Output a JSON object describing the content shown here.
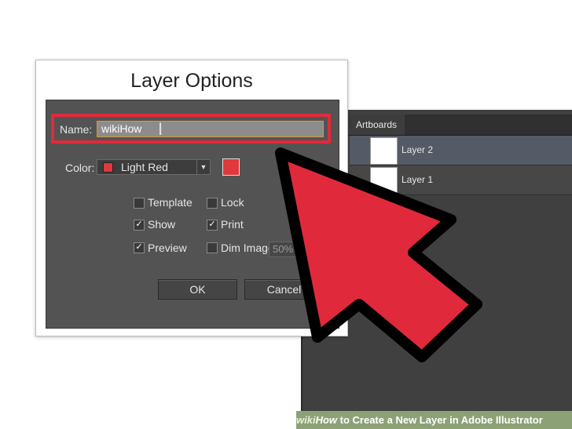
{
  "dialog": {
    "title": "Layer Options",
    "name_label": "Name:",
    "name_value": "wikiHow",
    "color_label": "Color:",
    "color_value": "Light Red",
    "swatch_color": "#e0383c",
    "checkboxes": {
      "template": {
        "label": "Template",
        "checked": false
      },
      "lock": {
        "label": "Lock",
        "checked": false
      },
      "show": {
        "label": "Show",
        "checked": true
      },
      "print": {
        "label": "Print",
        "checked": true
      },
      "preview": {
        "label": "Preview",
        "checked": true
      },
      "dim_images": {
        "label": "Dim Images to:",
        "checked": false
      }
    },
    "dim_value": "50%",
    "ok_label": "OK",
    "cancel_label": "Cancel"
  },
  "layers_panel": {
    "tab_label": "Artboards",
    "layers": [
      {
        "name": "Layer 2",
        "selected": true
      },
      {
        "name": "Layer 1",
        "selected": false
      }
    ]
  },
  "caption": {
    "wiki": "wiki",
    "how": "How",
    "text": " to Create a New Layer in Adobe Illustrator"
  },
  "colors": {
    "highlight": "#e2293b",
    "arrow_fill": "#e02a3c"
  }
}
